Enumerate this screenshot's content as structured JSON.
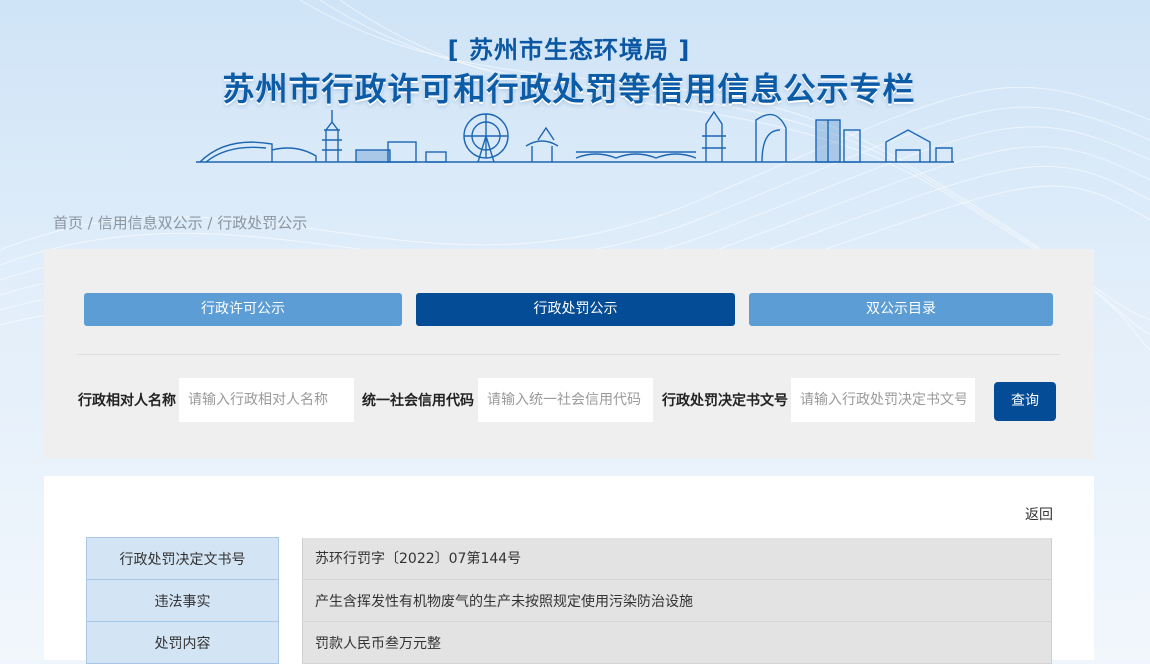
{
  "header": {
    "subtitle": "[ 苏州市生态环境局 ]",
    "title": "苏州市行政许可和行政处罚等信用信息公示专栏"
  },
  "breadcrumb": {
    "items": [
      "首页",
      "信用信息双公示",
      "行政处罚公示"
    ],
    "separator": " / "
  },
  "tabs": [
    {
      "label": "行政许可公示",
      "active": false
    },
    {
      "label": "行政处罚公示",
      "active": true
    },
    {
      "label": "双公示目录",
      "active": false
    }
  ],
  "search": {
    "party_name_label": "行政相对人名称",
    "party_name_placeholder": "请输入行政相对人名称",
    "credit_code_label": "统一社会信用代码",
    "credit_code_placeholder": "请输入统一社会信用代码",
    "decision_no_label": "行政处罚决定书文号",
    "decision_no_placeholder": "请输入行政处罚决定书文号",
    "query_label": "查询"
  },
  "detail": {
    "back_label": "返回",
    "rows": [
      {
        "key": "行政处罚决定文书号",
        "value": "苏环行罚字〔2022〕07第144号"
      },
      {
        "key": "违法事实",
        "value": "产生含挥发性有机物废气的生产未按照规定使用污染防治设施"
      },
      {
        "key": "处罚内容",
        "value": "罚款人民币叁万元整"
      }
    ]
  },
  "colors": {
    "primary_dark": "#044c95",
    "primary_light": "#5b9dd4",
    "title_blue": "#0b5ba6"
  }
}
